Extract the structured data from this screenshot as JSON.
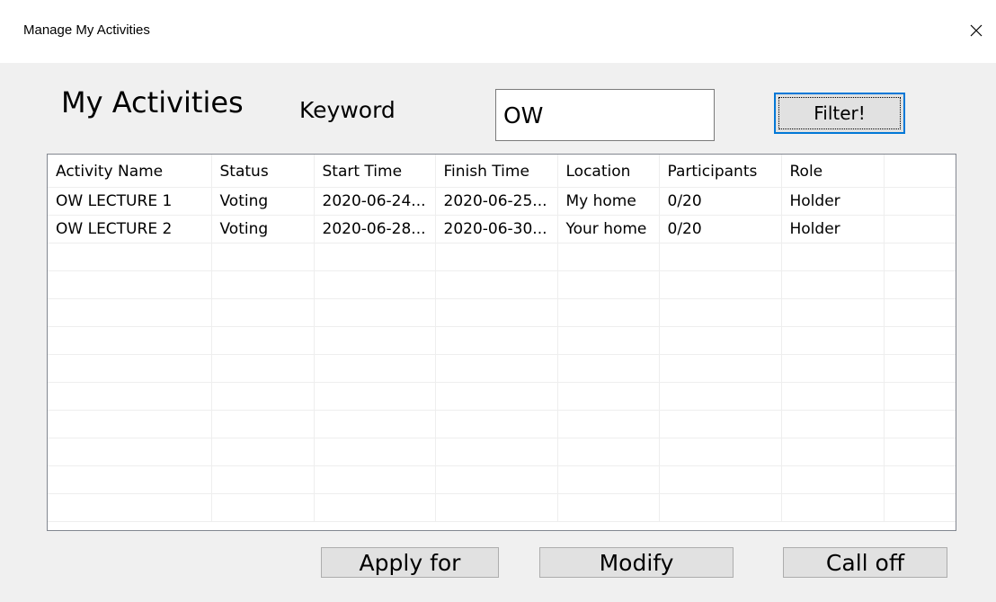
{
  "window": {
    "title": "Manage My Activities",
    "close_label": "×"
  },
  "header": {
    "heading": "My Activities",
    "keyword_label": "Keyword",
    "keyword_value": "OW",
    "filter_label": "Filter!"
  },
  "table": {
    "columns": [
      "Activity Name",
      "Status",
      "Start Time",
      "Finish Time",
      "Location",
      "Participants",
      "Role",
      ""
    ],
    "rows": [
      [
        "OW LECTURE 1",
        "Voting",
        "2020-06-24...",
        "2020-06-25...",
        "My home",
        "0/20",
        "Holder",
        ""
      ],
      [
        "OW LECTURE 2",
        "Voting",
        "2020-06-28...",
        "2020-06-30...",
        "Your home",
        "0/20",
        "Holder",
        ""
      ]
    ],
    "empty_row_count": 10
  },
  "actions": {
    "apply_label": "Apply for",
    "modify_label": "Modify",
    "calloff_label": "Call off"
  },
  "colors": {
    "window_bg": "#f0f0f0",
    "focus_border": "#0078d7",
    "button_bg": "#e1e1e1",
    "grid_line": "#eeeeee"
  },
  "icons": {
    "close": "close-icon"
  }
}
